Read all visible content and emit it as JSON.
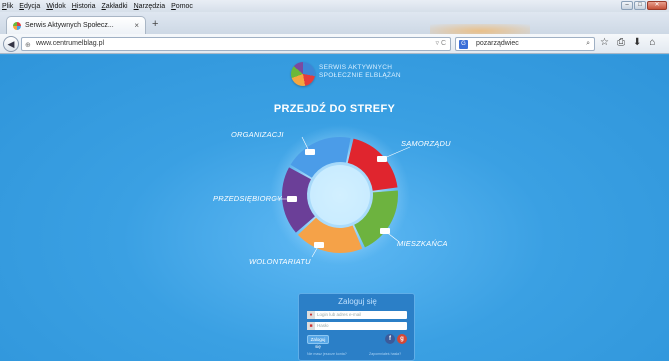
{
  "menu": [
    "Plik",
    "Edycja",
    "Widok",
    "Historia",
    "Zakładki",
    "Narzędzia",
    "Pomoc"
  ],
  "window_buttons": {
    "minimize": "–",
    "maximize": "□",
    "close": "✕"
  },
  "tab": {
    "title": "Serwis Aktywnych Społecz...",
    "close": "×",
    "new_tab": "+"
  },
  "address": {
    "url": "www.centrumelblag.pl",
    "right_icons": "▿ C"
  },
  "search": {
    "engine_glyph": "G",
    "value": "pozarządwiec",
    "icon": "⌕"
  },
  "toolbar_icons": [
    "☆",
    "⎙",
    "⬇",
    "⌂"
  ],
  "site": {
    "logo_line1": "SERWIS AKTYWNYCH",
    "logo_line2": "SPOŁECZNIE ELBLĄŻAN",
    "heading": "PRZEJDŹ DO STREFY"
  },
  "zones": [
    {
      "label": "ORGANIZACJI",
      "color": "#4b9ce8"
    },
    {
      "label": "SAMORZĄDU",
      "color": "#e0252e"
    },
    {
      "label": "MIESZKAŃCA",
      "color": "#6db33f"
    },
    {
      "label": "WOLONTARIATU",
      "color": "#f5a248"
    },
    {
      "label": "PRZEDSIĘBIORCY",
      "color": "#6b3f98"
    }
  ],
  "login": {
    "title": "Zaloguj się",
    "login_placeholder": "Login lub adres e-mail",
    "password_placeholder": "Hasło",
    "button": "Zaloguj się",
    "facebook": "f",
    "google": "g",
    "register_link": "Nie masz jeszcze konta?",
    "forgot_link": "Zapomniałeś hasła?"
  }
}
